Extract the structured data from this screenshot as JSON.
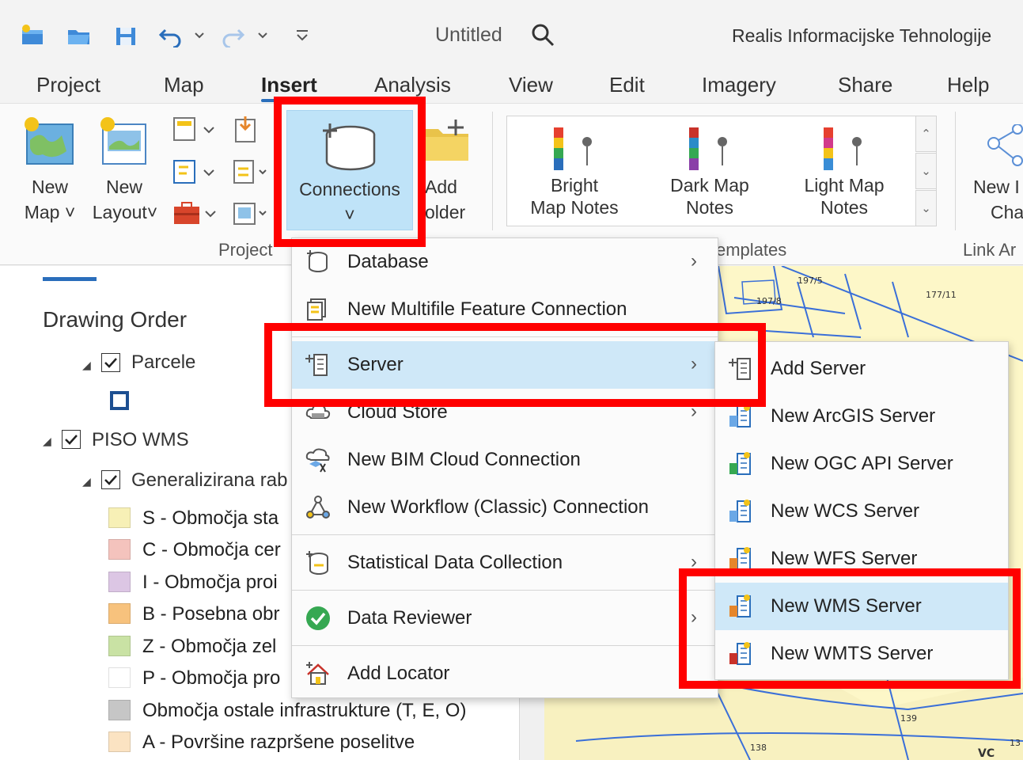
{
  "quick_access": {
    "icons": [
      "new-project-icon",
      "open-project-icon",
      "save-project-icon",
      "undo-icon",
      "undo-dropdown-icon",
      "redo-icon",
      "redo-dropdown-icon",
      "customize-toolbar-icon"
    ]
  },
  "title_bar": {
    "document_title": "Untitled",
    "organization": "Realis Informacijske Tehnologije"
  },
  "tabs": [
    "Project",
    "Map",
    "Insert",
    "Analysis",
    "View",
    "Edit",
    "Imagery",
    "Share",
    "Help"
  ],
  "active_tab": "Insert",
  "ribbon": {
    "project_group": {
      "label": "Project",
      "new_map_line1": "New",
      "new_map_line2": "Map ˅",
      "new_layout_line1": "New",
      "new_layout_line2": "Layout˅"
    },
    "connections_label": "Connections",
    "connections_arrow": "˅",
    "add_folder_line1": "Add",
    "add_folder_line2": "older",
    "layer_templates": {
      "label": "emplates",
      "items": [
        {
          "line1": "Bright",
          "line2": "Map Notes"
        },
        {
          "line1": "Dark Map",
          "line2": "Notes"
        },
        {
          "line1": "Light Map",
          "line2": "Notes"
        }
      ]
    },
    "link_group": {
      "label": "Link Ar",
      "button_line1": "New I",
      "button_line2": "Cha"
    }
  },
  "contents_pane": {
    "title": "Drawing Order",
    "layers": [
      {
        "name": "Parcele"
      },
      {
        "name": "PISO WMS"
      },
      {
        "name": "Generalizirana rab"
      }
    ],
    "legend": [
      {
        "label": "S - Območja sta",
        "color": "#f7f0b6"
      },
      {
        "label": "C - Območja cer",
        "color": "#f4c3bd"
      },
      {
        "label": "I - Območja proi",
        "color": "#dcc6e4"
      },
      {
        "label": "B - Posebna obr",
        "color": "#f7c27d"
      },
      {
        "label": "Z - Območja zel",
        "color": "#c9e2a4"
      },
      {
        "label": "P - Območja pro",
        "color": "#ffffff"
      },
      {
        "label": "Območja ostale infrastrukture (T, E, O)",
        "color": "#c6c6c6"
      },
      {
        "label": "A - Površine razpršene poselitve",
        "color": "#fbe3c2"
      }
    ]
  },
  "map_labels": [
    "197/5",
    "197/8",
    "177/11",
    "139",
    "138",
    "VC",
    "13"
  ],
  "connections_menu": {
    "items": [
      {
        "label": "Database",
        "has_submenu": true
      },
      {
        "label": "New Multifile Feature Connection",
        "has_submenu": false
      },
      {
        "label": "Server",
        "has_submenu": true,
        "highlighted": true
      },
      {
        "label": "Cloud Store",
        "has_submenu": true
      },
      {
        "label": "New BIM Cloud Connection",
        "has_submenu": false
      },
      {
        "label": "New Workflow (Classic) Connection",
        "has_submenu": false
      },
      {
        "label": "Statistical Data Collection",
        "has_submenu": true
      },
      {
        "label": "Data Reviewer",
        "has_submenu": true
      },
      {
        "label": "Add Locator",
        "has_submenu": false
      }
    ],
    "arrow": "›"
  },
  "server_submenu": {
    "items": [
      {
        "label": "Add Server"
      },
      {
        "label": "New ArcGIS Server"
      },
      {
        "label": "New OGC API Server"
      },
      {
        "label": "New WCS Server"
      },
      {
        "label": "New WFS Server"
      },
      {
        "label": "New WMS Server",
        "highlighted": true
      },
      {
        "label": "New WMTS Server"
      }
    ]
  },
  "colors": {
    "accent": "#2a6ebb",
    "highlight": "#cfe8f8",
    "connections_pressed": "#bfe3f8",
    "annotation": "#ff0000",
    "map_fill": "#fdf7c8",
    "map_lines": "#3a6fd8"
  }
}
